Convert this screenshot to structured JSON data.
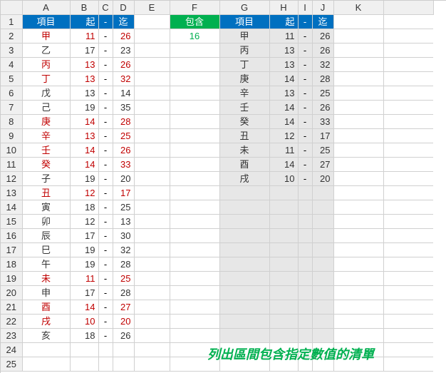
{
  "columns": [
    "A",
    "B",
    "C",
    "D",
    "E",
    "F",
    "G",
    "H",
    "I",
    "J",
    "K"
  ],
  "header": {
    "left": {
      "item": "項目",
      "from": "起",
      "dash": "-",
      "to": "迄"
    },
    "middle": {
      "contains": "包含"
    },
    "right": {
      "item": "項目",
      "from": "起",
      "dash": "-",
      "to": "迄"
    }
  },
  "contains_value": "16",
  "caption": "列出區間包含指定數值的清單",
  "dash_char": "-",
  "left_table": [
    {
      "name": "甲",
      "from": "11",
      "to": "26",
      "hl": true
    },
    {
      "name": "乙",
      "from": "17",
      "to": "23",
      "hl": false
    },
    {
      "name": "丙",
      "from": "13",
      "to": "26",
      "hl": true
    },
    {
      "name": "丁",
      "from": "13",
      "to": "32",
      "hl": true
    },
    {
      "name": "戊",
      "from": "13",
      "to": "14",
      "hl": false
    },
    {
      "name": "己",
      "from": "19",
      "to": "35",
      "hl": false
    },
    {
      "name": "庚",
      "from": "14",
      "to": "28",
      "hl": true
    },
    {
      "name": "辛",
      "from": "13",
      "to": "25",
      "hl": true
    },
    {
      "name": "壬",
      "from": "14",
      "to": "26",
      "hl": true
    },
    {
      "name": "癸",
      "from": "14",
      "to": "33",
      "hl": true
    },
    {
      "name": "子",
      "from": "19",
      "to": "20",
      "hl": false
    },
    {
      "name": "丑",
      "from": "12",
      "to": "17",
      "hl": true
    },
    {
      "name": "寅",
      "from": "18",
      "to": "25",
      "hl": false
    },
    {
      "name": "卯",
      "from": "12",
      "to": "13",
      "hl": false
    },
    {
      "name": "辰",
      "from": "17",
      "to": "30",
      "hl": false
    },
    {
      "name": "巳",
      "from": "19",
      "to": "32",
      "hl": false
    },
    {
      "name": "午",
      "from": "19",
      "to": "28",
      "hl": false
    },
    {
      "name": "未",
      "from": "11",
      "to": "25",
      "hl": true
    },
    {
      "name": "申",
      "from": "17",
      "to": "28",
      "hl": false
    },
    {
      "name": "酉",
      "from": "14",
      "to": "27",
      "hl": true
    },
    {
      "name": "戌",
      "from": "10",
      "to": "20",
      "hl": true
    },
    {
      "name": "亥",
      "from": "18",
      "to": "26",
      "hl": false
    }
  ],
  "right_table": [
    {
      "name": "甲",
      "from": "11",
      "to": "26"
    },
    {
      "name": "丙",
      "from": "13",
      "to": "26"
    },
    {
      "name": "丁",
      "from": "13",
      "to": "32"
    },
    {
      "name": "庚",
      "from": "14",
      "to": "28"
    },
    {
      "name": "辛",
      "from": "13",
      "to": "25"
    },
    {
      "name": "壬",
      "from": "14",
      "to": "26"
    },
    {
      "name": "癸",
      "from": "14",
      "to": "33"
    },
    {
      "name": "丑",
      "from": "12",
      "to": "17"
    },
    {
      "name": "未",
      "from": "11",
      "to": "25"
    },
    {
      "name": "酉",
      "from": "14",
      "to": "27"
    },
    {
      "name": "戌",
      "from": "10",
      "to": "20"
    }
  ],
  "row_count": 25
}
